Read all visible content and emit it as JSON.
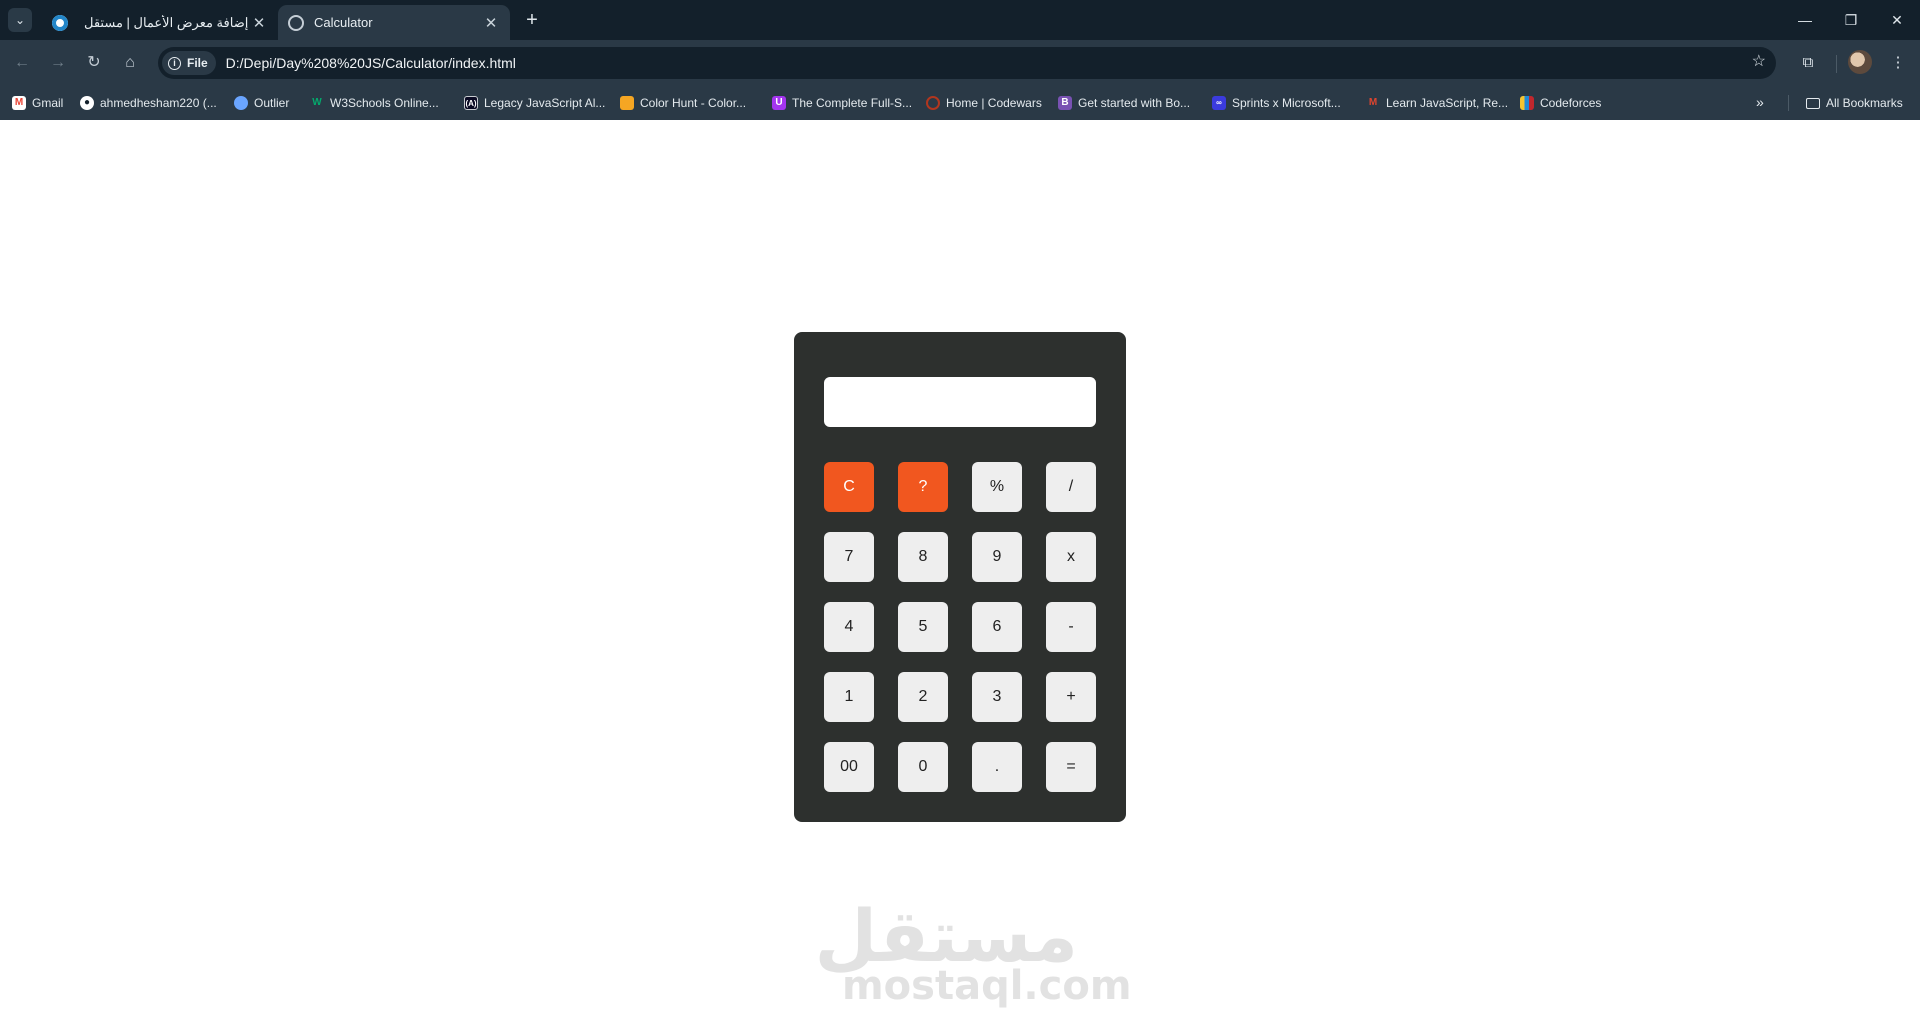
{
  "browser": {
    "tabs": [
      {
        "title": "إضافة معرض الأعمال | مستقل",
        "active": false
      },
      {
        "title": "Calculator",
        "active": true
      }
    ],
    "address": {
      "scheme_chip": "File",
      "url": "D:/Depi/Day%208%20JS/Calculator/index.html"
    },
    "bookmarks": [
      {
        "label": "Gmail",
        "icon": "gmail-icon",
        "color": "#ea4335"
      },
      {
        "label": "ahmedhesham220 (...",
        "icon": "github-icon",
        "color": "#ffffff"
      },
      {
        "label": "Outlier",
        "icon": "outlier-icon",
        "color": "#6aa5ff"
      },
      {
        "label": "W3Schools Online...",
        "icon": "w3schools-icon",
        "color": "#04aa6d"
      },
      {
        "label": "Legacy JavaScript Al...",
        "icon": "freecodecamp-icon",
        "color": "#0a0a23"
      },
      {
        "label": "Color Hunt - Color...",
        "icon": "colorhunt-icon",
        "color": "#f5a623"
      },
      {
        "label": "The Complete Full-S...",
        "icon": "udemy-icon",
        "color": "#a435f0"
      },
      {
        "label": "Home | Codewars",
        "icon": "codewars-icon",
        "color": "#b1361e"
      },
      {
        "label": "Get started with Bo...",
        "icon": "bootstrap-icon",
        "color": "#7952b3"
      },
      {
        "label": "Sprints x Microsoft...",
        "icon": "sprints-icon",
        "color": "#3b3bde"
      },
      {
        "label": "Learn JavaScript, Re...",
        "icon": "scrimba-icon",
        "color": "#e0452f"
      },
      {
        "label": "Codeforces",
        "icon": "codeforces-icon",
        "color": "#f4c430"
      }
    ],
    "all_bookmarks": "All Bookmarks"
  },
  "calculator": {
    "display_value": "",
    "keys": [
      "C",
      "?",
      "%",
      "/",
      "7",
      "8",
      "9",
      "x",
      "4",
      "5",
      "6",
      "-",
      "1",
      "2",
      "3",
      "+",
      "00",
      "0",
      ".",
      "="
    ],
    "accent_keys": [
      "C",
      "?"
    ],
    "accent_color": "#f1571f",
    "body_color": "#2d302e",
    "key_color": "#eeeeee"
  },
  "watermark": {
    "arabic": "مستقل",
    "latin": "mostaql.com"
  }
}
